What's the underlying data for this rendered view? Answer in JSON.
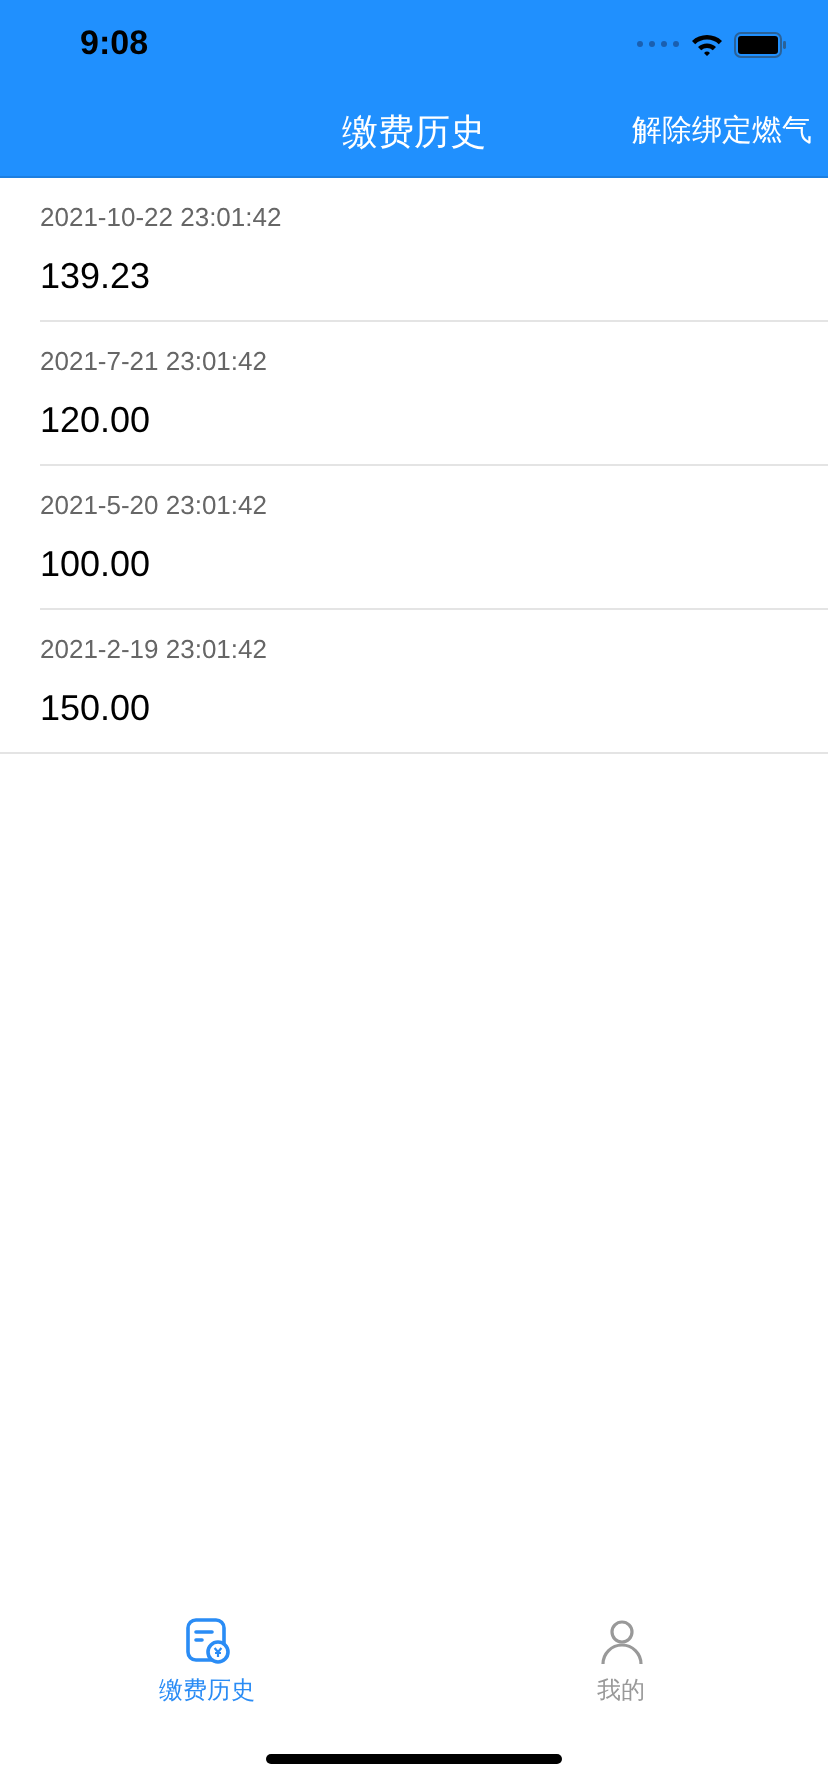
{
  "status_bar": {
    "time": "9:08"
  },
  "nav_bar": {
    "title": "缴费历史",
    "action": "解除绑定燃气"
  },
  "payments": [
    {
      "time": "2021-10-22 23:01:42",
      "amount": "139.23"
    },
    {
      "time": "2021-7-21 23:01:42",
      "amount": "120.00"
    },
    {
      "time": "2021-5-20 23:01:42",
      "amount": "100.00"
    },
    {
      "time": "2021-2-19 23:01:42",
      "amount": "150.00"
    }
  ],
  "tab_bar": [
    {
      "label": "缴费历史",
      "kind": "bill",
      "selected": true
    },
    {
      "label": "我的",
      "kind": "person",
      "selected": false
    }
  ]
}
